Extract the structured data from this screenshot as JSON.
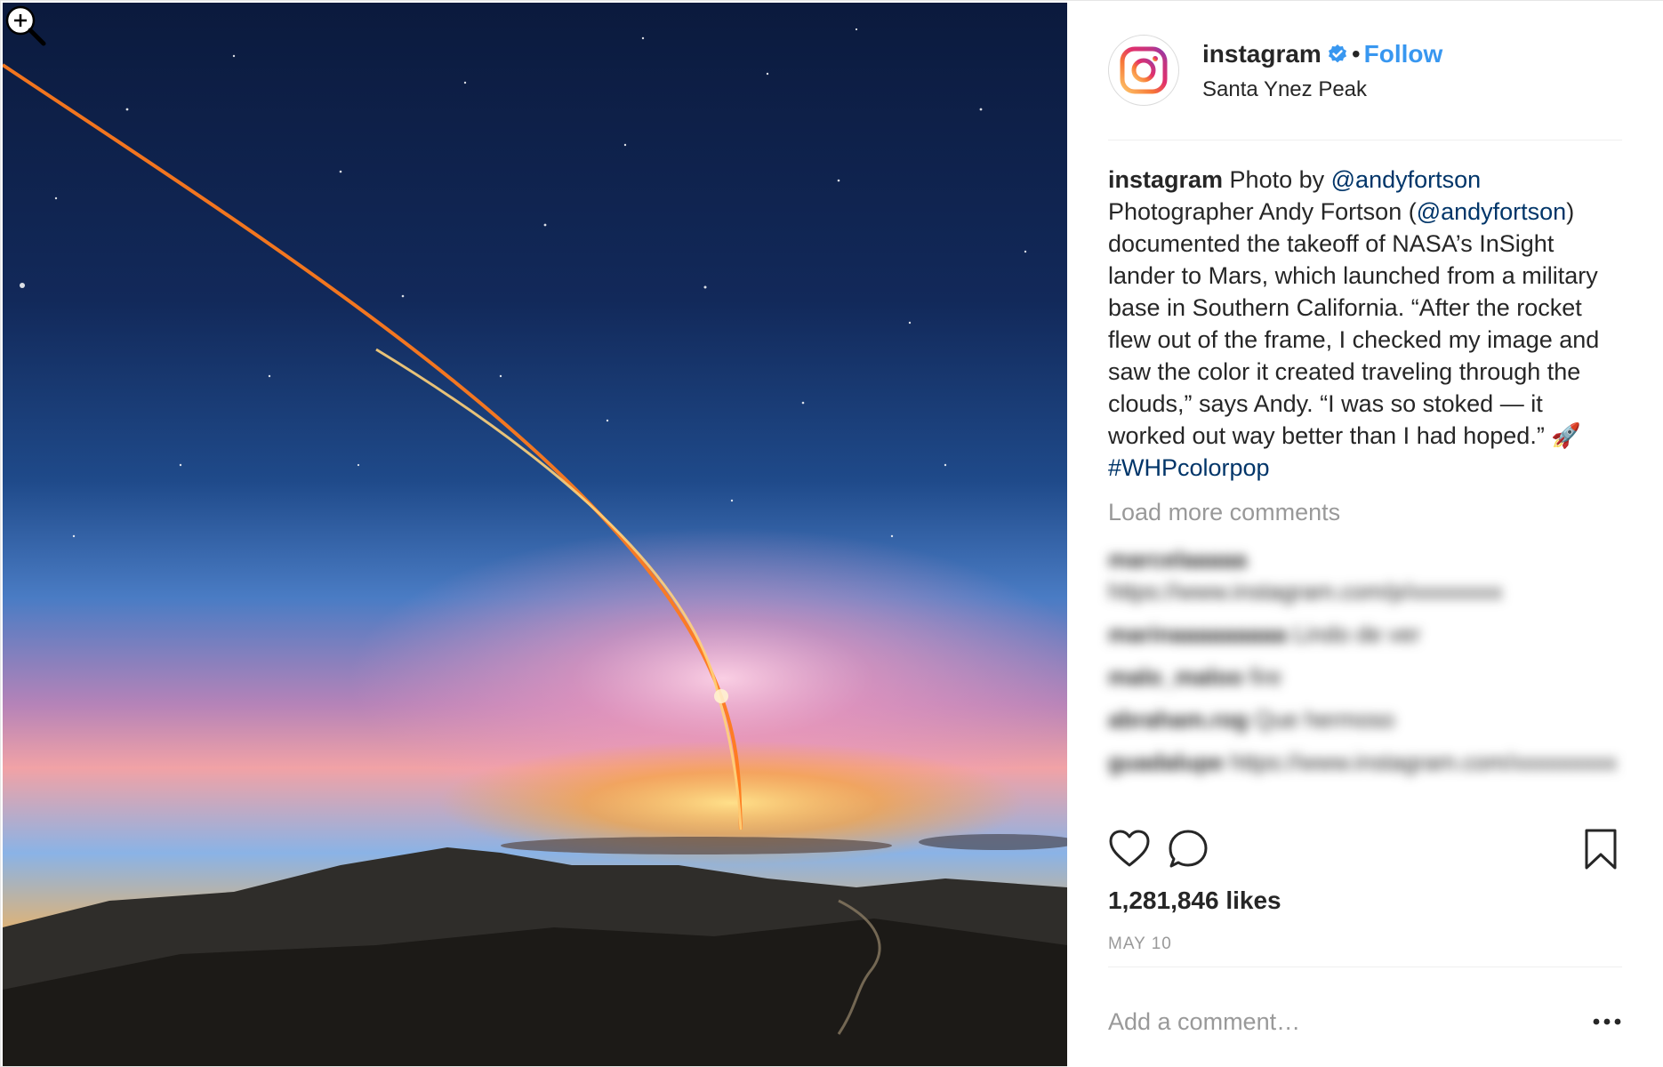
{
  "post": {
    "account": {
      "username": "instagram",
      "follow_label": "Follow",
      "separator": "•",
      "location": "Santa Ynez Peak"
    },
    "caption": {
      "username": "instagram",
      "p1": " Photo by ",
      "m1": "@andyfortson",
      "p2": " Photographer Andy Fortson (",
      "m2": "@andyfortson",
      "p3": ") documented the takeoff of NASA’s InSight lander to Mars, which launched from a military base in Southern California. “After the rocket flew out of the frame, I checked my image and saw the color it created traveling through the clouds,” says Andy. “I was so stoked — it worked out way better than I had hoped.” 🚀 ",
      "hashtag": "#WHPcolorpop"
    },
    "load_more": "Load more comments",
    "blurred_comments": [
      {
        "user": "marcelaaaaa",
        "text": "https://www.instagram.com/p/xxxxxxxx"
      },
      {
        "user": "marinaaaaaaaaa",
        "text": "Lindo de ver"
      },
      {
        "user": "malo_maloo",
        "text": "fire"
      },
      {
        "user": "abraham.rog",
        "text": "Que hermoso"
      },
      {
        "user": "guadalupe",
        "text": "https://www.instagram.com/xxxxxxxxx"
      }
    ],
    "likes": "1,281,846 likes",
    "date": "MAY 10",
    "comment_placeholder": "Add a comment…"
  },
  "icons": {
    "avatar": "instagram-logo-icon",
    "verified": "verified-badge-icon",
    "like": "heart-icon",
    "comment": "comment-bubble-icon",
    "save": "bookmark-icon",
    "more": "more-options-icon",
    "zoom": "zoom-in-cursor-icon"
  },
  "colors": {
    "link": "#3897f0",
    "mention": "#003569",
    "text": "#262626",
    "muted": "#999999"
  }
}
